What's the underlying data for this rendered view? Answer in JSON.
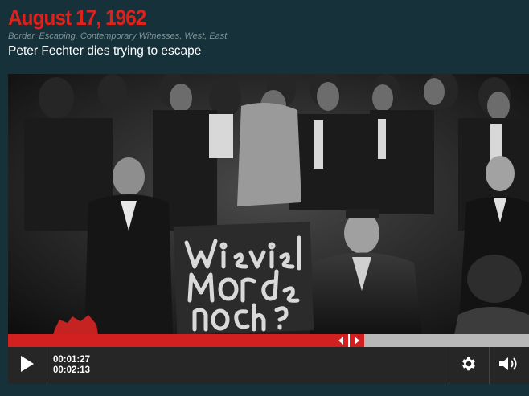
{
  "header": {
    "date": "August 17, 1962",
    "tags": "Border, Escaping, Contemporary Witnesses, West, East",
    "subtitle": "Peter Fechter dies trying to escape"
  },
  "video": {
    "sign_text_lines": [
      "Wieviel",
      "Morde",
      "noch?"
    ],
    "progress_fraction": 0.655
  },
  "player": {
    "current_time": "00:01:27",
    "total_time": "00:02:13",
    "icons": {
      "play": "play-icon",
      "settings": "gear-icon",
      "volume": "volume-icon",
      "seek_left": "chevron-left-icon",
      "seek_right": "chevron-right-icon"
    }
  },
  "colors": {
    "background": "#17313a",
    "accent": "#e0201b",
    "progress_fill": "#d21f1f",
    "progress_track": "#b8b8b8",
    "control_bar": "#262626"
  }
}
